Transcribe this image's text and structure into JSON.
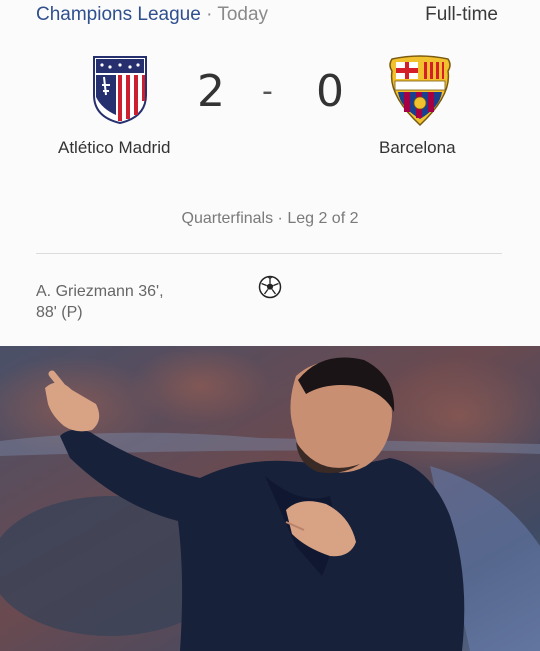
{
  "header": {
    "competition": "Champions League",
    "separator": "·",
    "date": "Today",
    "status": "Full-time"
  },
  "match": {
    "home_team": "Atlético Madrid",
    "away_team": "Barcelona",
    "home_score": "2",
    "score_separator": "-",
    "away_score": "0",
    "stage": "Quarterfinals · Leg 2 of 2",
    "home_scorers_line1": "A. Griezmann 36',",
    "home_scorers_line2": "88' (P)"
  },
  "icons": {
    "home_crest": "atletico-madrid-crest-icon",
    "away_crest": "barcelona-crest-icon",
    "goal": "soccer-ball-icon"
  },
  "colors": {
    "competition_link": "#2f4f8f",
    "atletico_red": "#cc1f2f",
    "atletico_blue": "#26306f",
    "barca_blue": "#1b3f8f",
    "barca_garnet": "#a50044",
    "barca_yellow": "#f2c12e"
  }
}
